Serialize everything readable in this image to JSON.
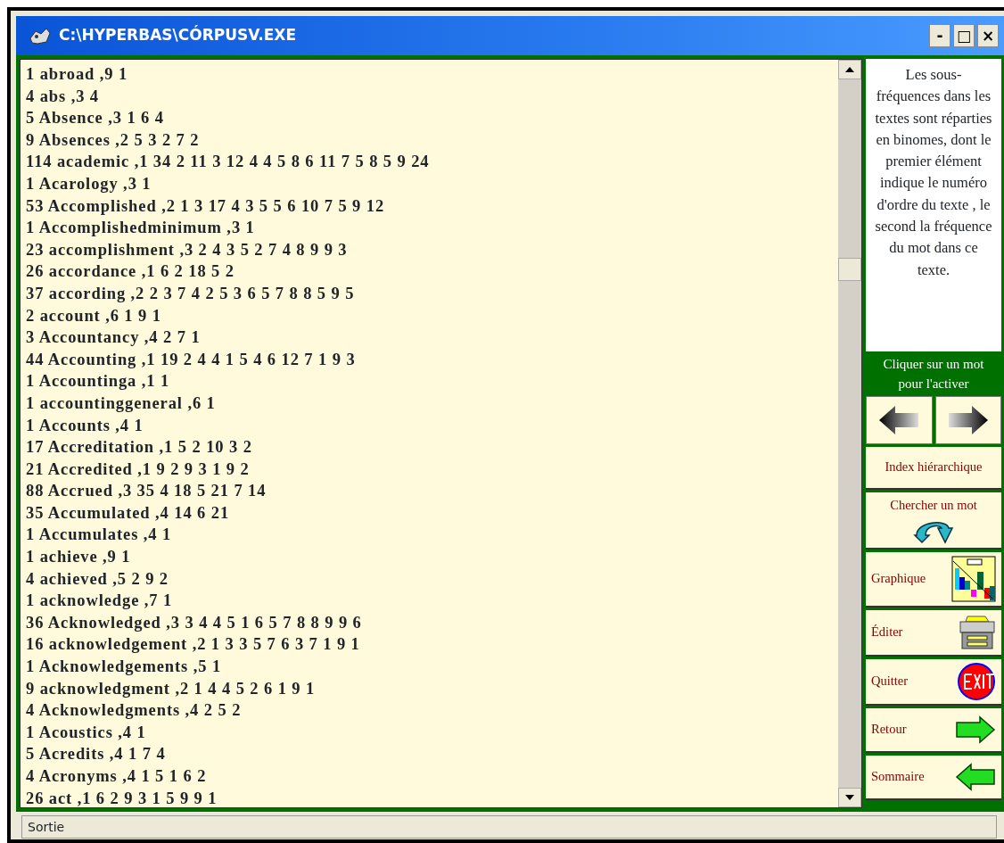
{
  "window": {
    "title": "C:\\HYPERBAS\\CÓRPUSV.EXE",
    "controls": [
      "-",
      "□",
      "×"
    ]
  },
  "word_list": [
    "1 abroad ,9 1",
    "4 abs ,3 4",
    "5 Absence ,3 1 6 4",
    "9 Absences ,2 5 3 2 7 2",
    "114 academic ,1 34 2 11 3 12 4 4 5 8 6 11 7 5 8 5 9 24",
    "1 Acarology ,3 1",
    "53 Accomplished ,2 1 3 17 4 3 5 5 6 10 7 5 9 12",
    "1 Accomplishedminimum ,3 1",
    "23 accomplishment ,3 2 4 3 5 2 7 4 8 9 9 3",
    "26 accordance ,1 6 2 18 5 2",
    "37 according ,2 2 3 7 4 2 5 3 6 5 7 8 8 5 9 5",
    "2 account ,6 1 9 1",
    "3 Accountancy ,4 2 7 1",
    "44 Accounting ,1 19 2 4 4 1 5 4 6 12 7 1 9 3",
    "1 Accountinga ,1 1",
    "1 accountinggeneral ,6 1",
    "1 Accounts ,4 1",
    "17 Accreditation ,1 5 2 10 3 2",
    "21 Accredited ,1 9 2 9 3 1 9 2",
    "88 Accrued ,3 35 4 18 5 21 7 14",
    "35 Accumulated ,4 14 6 21",
    "1 Accumulates ,4 1",
    "1 achieve ,9 1",
    "4 achieved ,5 2 9 2",
    "1 acknowledge ,7 1",
    "36 Acknowledged ,3 3 4 4 5 1 6 5 7 8 8 9 9 6",
    "16 acknowledgement ,2 1 3 3 5 7 6 3 7 1 9 1",
    "1 Acknowledgements ,5 1",
    "9 acknowledgment ,2 1 4 4 5 2 6 1 9 1",
    "4 Acknowledgments ,4 2 5 2",
    "1 Acoustics ,4 1",
    "5 Acredits ,4 1 7 4",
    "4 Acronyms ,4 1 5 1 6 2",
    "26 act ,1 6 2 9 3 1 5 9 9 1"
  ],
  "help_text": "Les sous-fréquences dans les textes sont réparties en binomes, dont le premier élément indique le numéro d'ordre du texte ,  le second la fréquence du mot dans ce texte.",
  "hint": "Cliquer sur un mot pour l'activer",
  "buttons": [
    {
      "kind": "arrows"
    },
    {
      "kind": "text",
      "label": "Index hiérarchique"
    },
    {
      "kind": "stacked",
      "label": "Chercher un mot"
    },
    {
      "kind": "side",
      "label": "Graphique"
    },
    {
      "kind": "side",
      "label": "Éditer"
    },
    {
      "kind": "side",
      "label": "Quitter"
    },
    {
      "kind": "side",
      "label": "Retour"
    },
    {
      "kind": "side",
      "label": "Sommaire"
    }
  ],
  "status_bar": "Sortie"
}
